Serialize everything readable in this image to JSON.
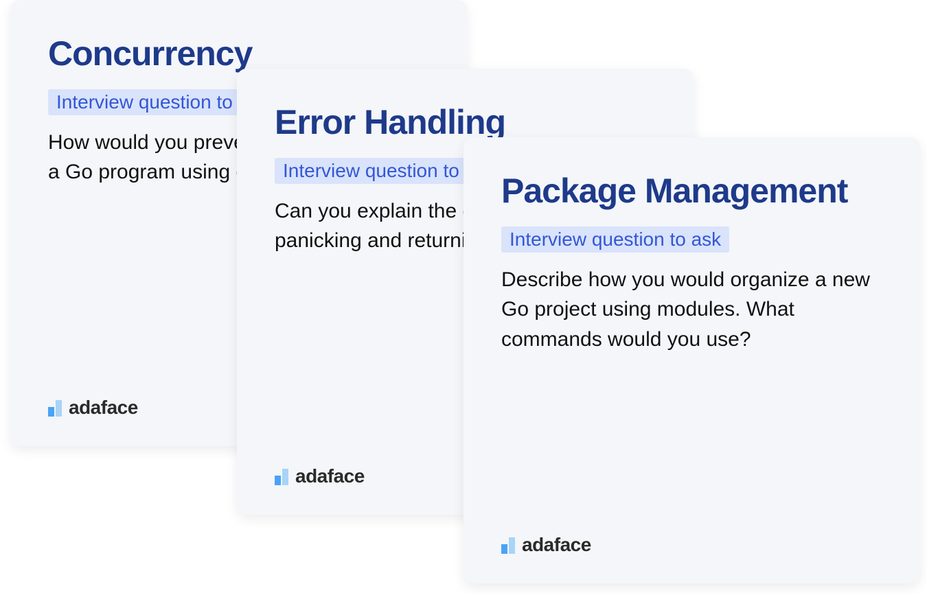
{
  "cards": [
    {
      "title": "Concurrency",
      "badge": "Interview question to ask",
      "body": "How would you prevent race conditions in a Go program using goroutines?"
    },
    {
      "title": "Error Handling",
      "badge": "Interview question to ask",
      "body": "Can you explain the difference between panicking and returning an error in Go?"
    },
    {
      "title": "Package Management",
      "badge": "Interview question to ask",
      "body": "Describe how you would organize a new Go project using modules. What commands would you use?"
    }
  ],
  "brand": "adaface"
}
